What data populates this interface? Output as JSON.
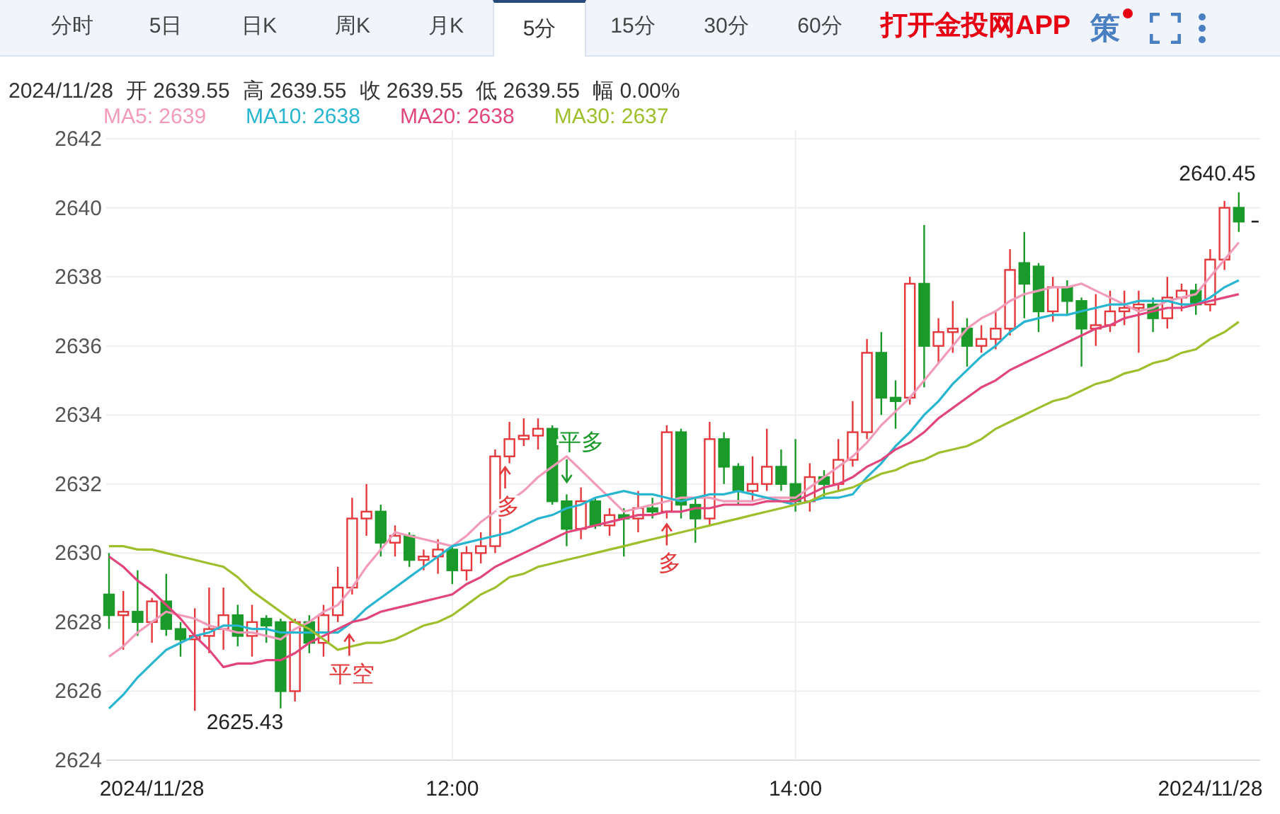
{
  "tabs": [
    {
      "label": "分时",
      "selected": false
    },
    {
      "label": "5日",
      "selected": false
    },
    {
      "label": "日K",
      "selected": false
    },
    {
      "label": "周K",
      "selected": false
    },
    {
      "label": "月K",
      "selected": false
    },
    {
      "label": "5分",
      "selected": true
    },
    {
      "label": "15分",
      "selected": false
    },
    {
      "label": "30分",
      "selected": false
    },
    {
      "label": "60分",
      "selected": false
    }
  ],
  "app_link": "打开金投网APP",
  "strategy": {
    "label": "策",
    "badge": true
  },
  "quote": [
    {
      "value": "2024/11/28"
    },
    {
      "label": "开",
      "value": "2639.55"
    },
    {
      "label": "高",
      "value": "2639.55"
    },
    {
      "label": "收",
      "value": "2639.55"
    },
    {
      "label": "低",
      "value": "2639.55"
    },
    {
      "label": "幅",
      "value": "0.00%"
    }
  ],
  "legend": [
    {
      "value": ": 2639"
    },
    {
      "value": ": 2638"
    },
    {
      "value": ": 2638"
    },
    {
      "value": ": 2637"
    }
  ],
  "chart": {
    "chart_data": {
      "type": "candlestick",
      "grid": true,
      "categories": [
        null,
        null,
        null,
        "2024/11/28",
        null,
        null,
        null,
        null,
        null,
        null,
        null,
        null,
        null,
        null,
        null,
        null,
        null,
        null,
        null,
        null,
        null,
        null,
        null,
        null,
        "12:00",
        null,
        null,
        null,
        null,
        null,
        null,
        null,
        null,
        null,
        null,
        null,
        null,
        null,
        null,
        null,
        null,
        null,
        null,
        null,
        null,
        null,
        null,
        null,
        "14:00",
        null,
        null,
        null,
        null,
        null,
        null,
        null,
        null,
        null,
        null,
        null,
        null,
        null,
        null,
        null,
        null,
        null,
        null,
        null,
        null,
        null,
        null,
        null,
        null,
        null,
        null,
        null,
        null,
        "2024/11/28",
        null,
        null
      ],
      "ylim": [
        2624,
        2642
      ],
      "yticks": [
        2624,
        2626,
        2628,
        2630,
        2632,
        2634,
        2636,
        2638,
        2640,
        2642
      ],
      "ohlc": [
        [
          2628.8,
          2630.0,
          2627.8,
          2628.2
        ],
        [
          2628.2,
          2628.9,
          2627.2,
          2628.3
        ],
        [
          2628.3,
          2629.5,
          2627.6,
          2628.0
        ],
        [
          2628.0,
          2628.7,
          2627.4,
          2628.6
        ],
        [
          2628.6,
          2629.4,
          2627.6,
          2627.8
        ],
        [
          2627.8,
          2628.0,
          2627.0,
          2627.5
        ],
        [
          2627.5,
          2628.4,
          2625.43,
          2627.6
        ],
        [
          2627.6,
          2629.0,
          2627.1,
          2627.8
        ],
        [
          2627.8,
          2629.0,
          2627.2,
          2628.2
        ],
        [
          2628.2,
          2628.5,
          2627.3,
          2627.6
        ],
        [
          2627.6,
          2628.5,
          2627.0,
          2628.0
        ],
        [
          2628.1,
          2628.2,
          2627.4,
          2627.9
        ],
        [
          2628.0,
          2628.1,
          2625.5,
          2626.0
        ],
        [
          2626.0,
          2628.1,
          2625.7,
          2628.0
        ],
        [
          2628.0,
          2628.2,
          2627.1,
          2627.4
        ],
        [
          2627.4,
          2628.5,
          2627.0,
          2628.2
        ],
        [
          2628.2,
          2629.6,
          2628.0,
          2629.0
        ],
        [
          2629.0,
          2631.6,
          2628.8,
          2631.0
        ],
        [
          2631.0,
          2632.0,
          2630.5,
          2631.2
        ],
        [
          2631.2,
          2631.4,
          2629.9,
          2630.3
        ],
        [
          2630.3,
          2630.8,
          2629.9,
          2630.5
        ],
        [
          2630.5,
          2630.6,
          2629.6,
          2629.8
        ],
        [
          2629.8,
          2630.1,
          2629.5,
          2629.9
        ],
        [
          2629.9,
          2630.4,
          2629.4,
          2630.1
        ],
        [
          2630.1,
          2630.2,
          2629.1,
          2629.5
        ],
        [
          2629.5,
          2630.2,
          2629.2,
          2630.0
        ],
        [
          2630.0,
          2630.6,
          2629.7,
          2630.2
        ],
        [
          2630.2,
          2633.0,
          2630.0,
          2632.8
        ],
        [
          2632.8,
          2633.8,
          2632.6,
          2633.3
        ],
        [
          2633.3,
          2633.9,
          2633.1,
          2633.4
        ],
        [
          2633.4,
          2633.9,
          2633.0,
          2633.6
        ],
        [
          2633.6,
          2633.7,
          2631.4,
          2631.5
        ],
        [
          2631.5,
          2631.7,
          2630.2,
          2630.7
        ],
        [
          2630.7,
          2631.9,
          2630.4,
          2631.5
        ],
        [
          2631.5,
          2631.6,
          2630.7,
          2630.8
        ],
        [
          2630.8,
          2631.3,
          2630.5,
          2631.1
        ],
        [
          2631.1,
          2631.3,
          2629.9,
          2631.0
        ],
        [
          2631.0,
          2631.8,
          2630.6,
          2631.3
        ],
        [
          2631.3,
          2631.6,
          2631.0,
          2631.2
        ],
        [
          2631.2,
          2633.7,
          2631.0,
          2633.5
        ],
        [
          2633.5,
          2633.6,
          2631.0,
          2631.4
        ],
        [
          2631.4,
          2631.6,
          2630.3,
          2631.0
        ],
        [
          2631.0,
          2633.8,
          2630.8,
          2633.3
        ],
        [
          2633.3,
          2633.5,
          2632.0,
          2632.5
        ],
        [
          2632.5,
          2632.6,
          2631.4,
          2631.8
        ],
        [
          2631.8,
          2632.8,
          2631.5,
          2632.0
        ],
        [
          2632.0,
          2633.6,
          2631.8,
          2632.5
        ],
        [
          2632.5,
          2633.0,
          2631.8,
          2632.0
        ],
        [
          2632.0,
          2633.3,
          2631.2,
          2631.5
        ],
        [
          2631.5,
          2632.6,
          2631.2,
          2632.2
        ],
        [
          2632.2,
          2632.4,
          2631.6,
          2632.0
        ],
        [
          2632.0,
          2633.3,
          2631.8,
          2632.7
        ],
        [
          2632.7,
          2634.4,
          2632.5,
          2633.5
        ],
        [
          2633.5,
          2636.2,
          2633.3,
          2635.8
        ],
        [
          2635.8,
          2636.4,
          2634.0,
          2634.5
        ],
        [
          2634.5,
          2635.0,
          2633.6,
          2634.4
        ],
        [
          2634.5,
          2638.0,
          2634.3,
          2637.8
        ],
        [
          2637.8,
          2639.5,
          2634.8,
          2636.0
        ],
        [
          2636.0,
          2636.8,
          2635.5,
          2636.4
        ],
        [
          2636.4,
          2637.3,
          2635.8,
          2636.5
        ],
        [
          2636.5,
          2636.8,
          2635.4,
          2636.0
        ],
        [
          2636.0,
          2636.6,
          2635.8,
          2636.2
        ],
        [
          2636.2,
          2637.0,
          2635.9,
          2636.5
        ],
        [
          2636.5,
          2638.8,
          2636.3,
          2638.2
        ],
        [
          2638.4,
          2639.3,
          2636.8,
          2637.8
        ],
        [
          2638.3,
          2638.4,
          2636.4,
          2637.0
        ],
        [
          2637.0,
          2638.0,
          2636.7,
          2637.7
        ],
        [
          2637.7,
          2637.9,
          2636.9,
          2637.3
        ],
        [
          2637.3,
          2637.4,
          2635.4,
          2636.5
        ],
        [
          2636.5,
          2637.5,
          2636.0,
          2636.6
        ],
        [
          2636.6,
          2637.6,
          2636.4,
          2637.0
        ],
        [
          2637.0,
          2637.6,
          2636.6,
          2637.1
        ],
        [
          2637.1,
          2637.6,
          2635.8,
          2637.2
        ],
        [
          2637.2,
          2637.4,
          2636.4,
          2636.8
        ],
        [
          2636.8,
          2638.0,
          2636.5,
          2637.4
        ],
        [
          2637.4,
          2637.8,
          2637.0,
          2637.6
        ],
        [
          2637.6,
          2637.8,
          2636.9,
          2637.2
        ],
        [
          2637.2,
          2638.8,
          2637.0,
          2638.5
        ],
        [
          2638.5,
          2640.2,
          2638.2,
          2640.0
        ],
        [
          2640.0,
          2640.45,
          2639.3,
          2639.6
        ]
      ],
      "series": [
        {
          "name": "MA5",
          "color": "#f29bb8",
          "type": "line",
          "values": [
            2627,
            2627.3,
            2627.7,
            2628.0,
            2628.3,
            2628.2,
            2628.1,
            2627.9,
            2627.8,
            2627.7,
            2627.7,
            2627.6,
            2627.5,
            2627.8,
            2628.0,
            2628.3,
            2628.5,
            2629.0,
            2629.6,
            2630.1,
            2630.6,
            2630.5,
            2630.4,
            2630.3,
            2630.2,
            2630.5,
            2630.9,
            2631.2,
            2631.5,
            2631.8,
            2632.2,
            2632.5,
            2632.8,
            2632.4,
            2632.0,
            2631.6,
            2631.2,
            2631.3,
            2631.4,
            2631.5,
            2631.6,
            2631.6,
            2631.6,
            2631.5,
            2631.5,
            2631.5,
            2631.6,
            2631.6,
            2631.6,
            2631.9,
            2632.2,
            2632.5,
            2632.8,
            2633.2,
            2633.7,
            2634.1,
            2634.5,
            2635.0,
            2635.5,
            2636.0,
            2636.5,
            2636.8,
            2637.0,
            2637.3,
            2637.5,
            2637.6,
            2637.7,
            2637.7,
            2637.8,
            2637.6,
            2637.4,
            2637.2,
            2637.0,
            2637.1,
            2637.3,
            2637.4,
            2637.5,
            2638.0,
            2638.5,
            2639.0
          ]
        },
        {
          "name": "MA10",
          "color": "#27b5cf",
          "type": "line",
          "values": [
            2625.5,
            2625.9,
            2626.4,
            2626.8,
            2627.2,
            2627.4,
            2627.6,
            2627.7,
            2627.9,
            2627.9,
            2627.8,
            2627.8,
            2627.7,
            2627.7,
            2627.7,
            2627.7,
            2627.7,
            2628.0,
            2628.4,
            2628.7,
            2629.0,
            2629.3,
            2629.6,
            2629.9,
            2630.2,
            2630.3,
            2630.4,
            2630.5,
            2630.6,
            2630.8,
            2631.0,
            2631.1,
            2631.3,
            2631.4,
            2631.6,
            2631.7,
            2631.8,
            2631.7,
            2631.7,
            2631.6,
            2631.5,
            2631.6,
            2631.7,
            2631.7,
            2631.8,
            2631.7,
            2631.6,
            2631.5,
            2631.4,
            2631.5,
            2631.6,
            2631.6,
            2631.7,
            2632.2,
            2632.6,
            2633.1,
            2633.5,
            2634.0,
            2634.4,
            2634.9,
            2635.3,
            2635.7,
            2636.0,
            2636.4,
            2636.7,
            2636.8,
            2636.9,
            2636.9,
            2637.0,
            2637.1,
            2637.2,
            2637.2,
            2637.3,
            2637.3,
            2637.3,
            2637.2,
            2637.2,
            2637.4,
            2637.7,
            2637.9
          ]
        },
        {
          "name": "MA20",
          "color": "#e2457c",
          "type": "line",
          "values": [
            2629.9,
            2629.6,
            2629.2,
            2628.9,
            2628.5,
            2628.1,
            2627.6,
            2627.2,
            2626.7,
            2626.8,
            2626.8,
            2626.9,
            2626.9,
            2627.1,
            2627.4,
            2627.6,
            2627.8,
            2628.0,
            2628.1,
            2628.3,
            2628.4,
            2628.5,
            2628.6,
            2628.7,
            2628.8,
            2629.1,
            2629.3,
            2629.6,
            2629.8,
            2630.0,
            2630.2,
            2630.4,
            2630.6,
            2630.7,
            2630.8,
            2630.9,
            2631.0,
            2631.1,
            2631.1,
            2631.2,
            2631.2,
            2631.3,
            2631.3,
            2631.4,
            2631.4,
            2631.4,
            2631.5,
            2631.5,
            2631.5,
            2631.7,
            2631.9,
            2632.0,
            2632.2,
            2632.5,
            2632.7,
            2633.0,
            2633.2,
            2633.5,
            2633.9,
            2634.2,
            2634.5,
            2634.8,
            2635.0,
            2635.3,
            2635.5,
            2635.7,
            2635.9,
            2636.1,
            2636.3,
            2636.5,
            2636.6,
            2636.8,
            2636.9,
            2637.0,
            2637.1,
            2637.1,
            2637.2,
            2637.3,
            2637.4,
            2637.5
          ]
        },
        {
          "name": "MA30",
          "color": "#9dbf2c",
          "type": "line",
          "values": [
            2630.2,
            2630.2,
            2630.1,
            2630.1,
            2630.0,
            2629.9,
            2629.8,
            2629.7,
            2629.6,
            2629.3,
            2628.9,
            2628.6,
            2628.3,
            2628.0,
            2627.8,
            2627.5,
            2627.2,
            2627.3,
            2627.4,
            2627.4,
            2627.5,
            2627.7,
            2627.9,
            2628.0,
            2628.2,
            2628.5,
            2628.8,
            2629.0,
            2629.3,
            2629.4,
            2629.6,
            2629.7,
            2629.8,
            2629.9,
            2630.0,
            2630.1,
            2630.2,
            2630.3,
            2630.4,
            2630.5,
            2630.6,
            2630.7,
            2630.8,
            2630.9,
            2631.0,
            2631.1,
            2631.2,
            2631.3,
            2631.4,
            2631.5,
            2631.7,
            2631.8,
            2631.9,
            2632.1,
            2632.3,
            2632.4,
            2632.6,
            2632.7,
            2632.9,
            2633.0,
            2633.1,
            2633.3,
            2633.6,
            2633.8,
            2634.0,
            2634.2,
            2634.4,
            2634.5,
            2634.7,
            2634.9,
            2635.0,
            2635.2,
            2635.3,
            2635.5,
            2635.6,
            2635.8,
            2635.9,
            2636.2,
            2636.4,
            2636.7
          ]
        }
      ],
      "annotations": [
        "2640.45",
        "2625.43",
        "平多",
        "多",
        "多",
        "平空"
      ]
    }
  }
}
